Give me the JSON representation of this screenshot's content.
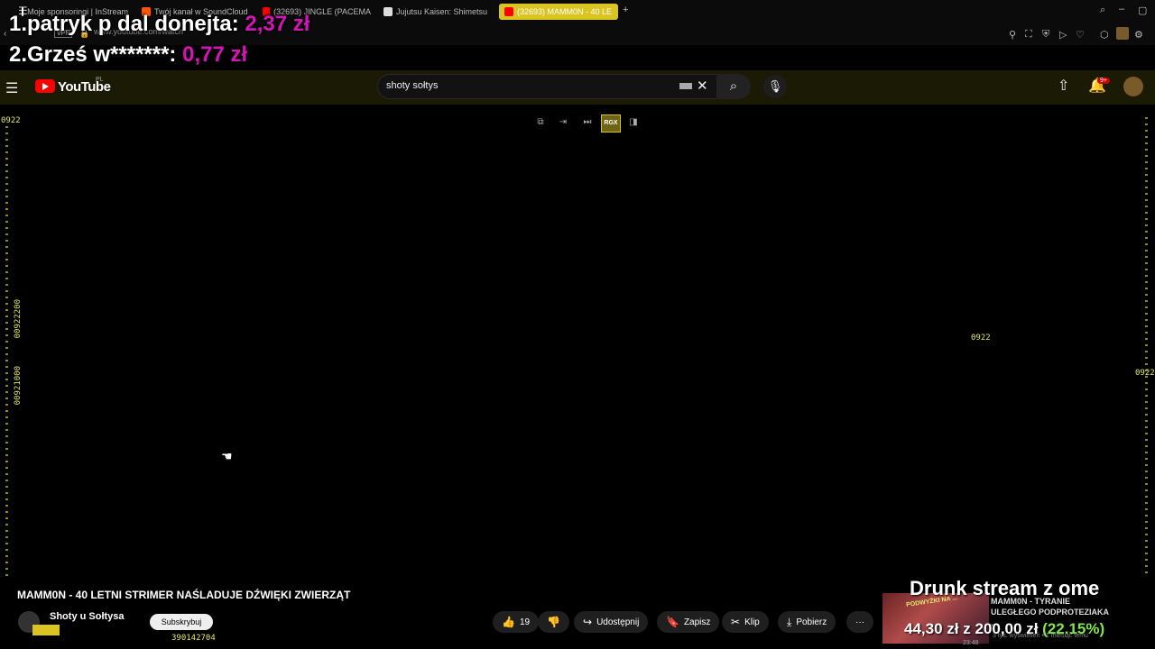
{
  "browser": {
    "tabs": [
      {
        "label": "Moje sponsoringi | InStream",
        "color": "#ffffff"
      },
      {
        "label": "Twój kanał w SoundCloud",
        "color": "#ff5500"
      },
      {
        "label": "(32693) JINGLE (PACEMA",
        "color": "#ff0000"
      },
      {
        "label": "Jujutsu Kaisen: Shimetsu",
        "color": "#dddddd"
      },
      {
        "label": "(32693) MAMM0N - 40 LE",
        "color": "#ff0000",
        "active": true
      }
    ],
    "new_tab": "+",
    "url": "www.youtube.com/watch",
    "vpn": "VPN"
  },
  "donations": [
    {
      "text": "1.patryk p dal donejta: ",
      "amount": "2,37 zł"
    },
    {
      "text": "2.Grześ w*******: ",
      "amount": "0,77 zł"
    }
  ],
  "youtube": {
    "logo_text": "YouTube",
    "region": "PL",
    "search_value": "shoty sołtys",
    "notifications_badge": "9+"
  },
  "player_controls": [
    "miniplayer",
    "exit",
    "next",
    "RGX",
    "theater"
  ],
  "markers": {
    "top_left": "0922",
    "mid_right": "0922",
    "far_right": "0922",
    "vertical_1": "00922200",
    "vertical_2": "00921000",
    "bottom_numbers": "390142704"
  },
  "video": {
    "title": "MAMM0N - 40 LETNI STRIMER NAŚLADUJE DŹWIĘKI ZWIERZĄT",
    "channel": "Shoty u Sołtysa",
    "subscribe_label": "Subskrybuj",
    "likes": "19",
    "share_label": "Udostępnij",
    "save_label": "Zapisz",
    "clip_label": "Klip",
    "download_label": "Pobierz",
    "more_label": "···"
  },
  "stream_overlay": {
    "title": "Drunk stream z ome",
    "goal_current": "44,30 zł",
    "goal_of": "z",
    "goal_target": "200,00 zł",
    "goal_percent": "(22.15%)",
    "goal_fraction": 0.2215,
    "side_video_title": "MAMM0N - TYRANIE ULEGŁEGO PODPROTEZIAKA ...",
    "thumb_text": "PODWYŻKI NA ...",
    "side_views": "3 tys. wyświetleń • 1 miesiąc temu",
    "clock": "23:48"
  }
}
